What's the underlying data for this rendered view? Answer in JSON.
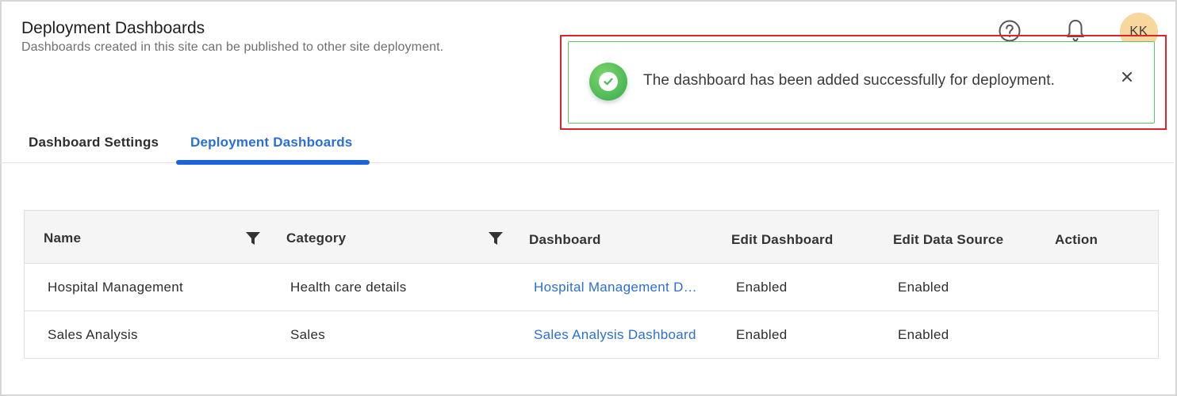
{
  "header": {
    "title": "Deployment Dashboards",
    "subtitle": "Dashboards created in this site can be published to other site deployment."
  },
  "top_bar": {
    "help_icon": "question-circle-icon",
    "notification_icon": "bell-icon",
    "avatar_initials": "KK"
  },
  "toast": {
    "message": "The dashboard has been added successfully for deployment.",
    "status_icon": "check-circle-icon",
    "close_icon": "close-icon",
    "border_color": "#5cc46a",
    "highlight_color": "#e0232a"
  },
  "tabs": [
    {
      "label": "Dashboard Settings",
      "active": false
    },
    {
      "label": "Deployment Dashboards",
      "active": true
    }
  ],
  "table": {
    "columns": [
      "Name",
      "Category",
      "Dashboard",
      "Edit Dashboard",
      "Edit Data Source",
      "Action"
    ],
    "rows": [
      {
        "name": "Hospital Management",
        "category": "Health care details",
        "dashboard": "Hospital Management Dashboard",
        "edit_dashboard": "Enabled",
        "edit_data_source": "Enabled",
        "action": ""
      },
      {
        "name": "Sales Analysis",
        "category": "Sales",
        "dashboard": "Sales Analysis Dashboard",
        "edit_dashboard": "Enabled",
        "edit_data_source": "Enabled",
        "action": ""
      }
    ]
  },
  "colors": {
    "accent": "#1d63e0",
    "link": "#2a6fd6",
    "success": "#4bb856",
    "avatar_bg": "#f7d79b"
  }
}
